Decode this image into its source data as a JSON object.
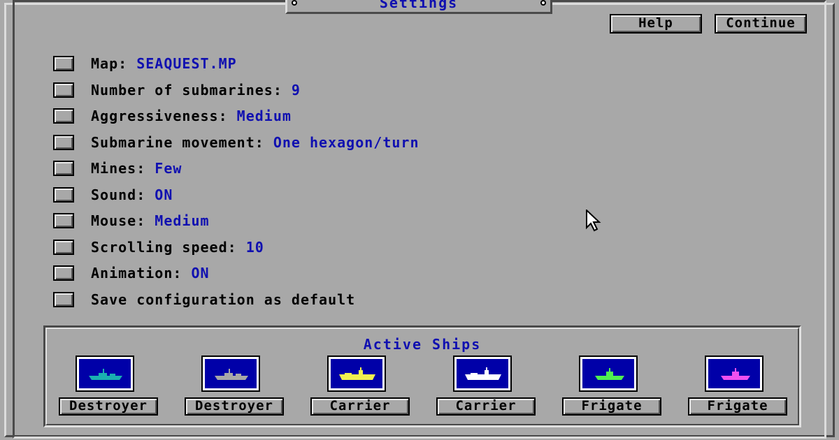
{
  "window": {
    "title": "Settings"
  },
  "toolbar": {
    "help_label": "Help",
    "continue_label": "Continue"
  },
  "settings": [
    {
      "label": "Map: ",
      "value": "SEAQUEST.MP"
    },
    {
      "label": "Number of submarines: ",
      "value": "9"
    },
    {
      "label": "Aggressiveness: ",
      "value": "Medium"
    },
    {
      "label": "Submarine movement: ",
      "value": "One hexagon/turn"
    },
    {
      "label": "Mines: ",
      "value": "Few"
    },
    {
      "label": "Sound: ",
      "value": "ON"
    },
    {
      "label": "Mouse: ",
      "value": "Medium"
    },
    {
      "label": "Scrolling speed: ",
      "value": "10"
    },
    {
      "label": "Animation: ",
      "value": "ON"
    },
    {
      "label": "Save configuration as default",
      "value": ""
    }
  ],
  "ships": {
    "title": "Active Ships",
    "items": [
      {
        "label": "Destroyer",
        "color": "#1ab0b0",
        "icon": "destroyer-ship-icon"
      },
      {
        "label": "Destroyer",
        "color": "#a8a8a8",
        "icon": "destroyer-ship-icon"
      },
      {
        "label": "Carrier",
        "color": "#f0f050",
        "icon": "carrier-ship-icon"
      },
      {
        "label": "Carrier",
        "color": "#ffffff",
        "icon": "carrier-ship-icon"
      },
      {
        "label": "Frigate",
        "color": "#50f050",
        "icon": "frigate-ship-icon"
      },
      {
        "label": "Frigate",
        "color": "#f050f0",
        "icon": "frigate-ship-icon"
      }
    ]
  },
  "colors": {
    "background": "#a8a8a8",
    "accent": "#1010b0",
    "ship_bg": "#0000a8"
  }
}
